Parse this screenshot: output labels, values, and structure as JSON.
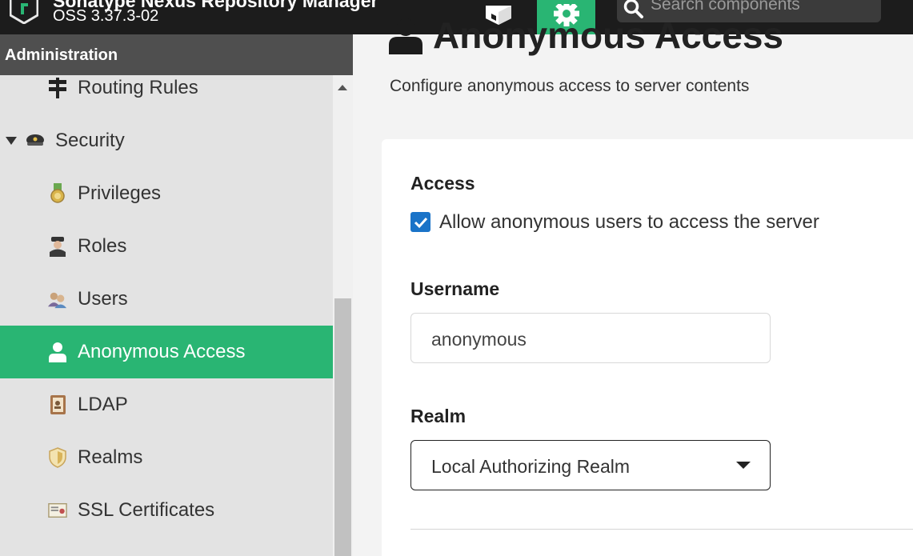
{
  "header": {
    "app_title": "Sonatype Nexus Repository Manager",
    "version": "OSS 3.37.3-02",
    "search_placeholder": "Search components",
    "browse_icon": "cube-icon",
    "admin_icon": "gear-icon"
  },
  "sidebar": {
    "title": "Administration",
    "items": [
      {
        "label": "Routing Rules",
        "icon": "signpost-icon"
      },
      {
        "label": "Security",
        "icon": "police-cap-icon"
      },
      {
        "label": "Privileges",
        "icon": "medal-icon"
      },
      {
        "label": "Roles",
        "icon": "officer-icon"
      },
      {
        "label": "Users",
        "icon": "users-icon"
      },
      {
        "label": "Anonymous Access",
        "icon": "user-icon"
      },
      {
        "label": "LDAP",
        "icon": "address-book-icon"
      },
      {
        "label": "Realms",
        "icon": "shield-icon"
      },
      {
        "label": "SSL Certificates",
        "icon": "certificate-icon"
      }
    ],
    "active": "Anonymous Access"
  },
  "main": {
    "title": "Anonymous Access",
    "description": "Configure anonymous access to server contents",
    "access_label": "Access",
    "allow_checkbox_label": "Allow anonymous users to access the server",
    "allow_checked": true,
    "username_label": "Username",
    "username_value": "anonymous",
    "realm_label": "Realm",
    "realm_value": "Local Authorizing Realm"
  },
  "colors": {
    "accent": "#29b573",
    "topbar": "#1c1c1c",
    "sidebar_header": "#4f4f4f",
    "checkbox": "#1a73c8"
  }
}
